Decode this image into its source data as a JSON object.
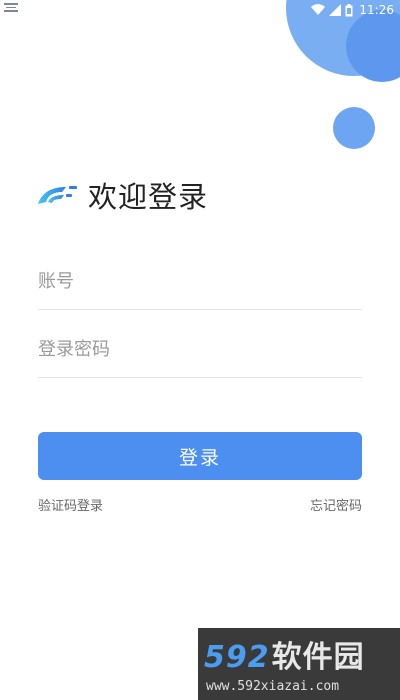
{
  "status_bar": {
    "time": "11:26",
    "icons": [
      "notification-icon",
      "wifi-icon",
      "signal-icon",
      "battery-icon"
    ]
  },
  "welcome": {
    "title": "欢迎登录",
    "logo_icon": "brand-logo-icon"
  },
  "form": {
    "account_placeholder": "账号",
    "password_placeholder": "登录密码",
    "login_label": "登录",
    "sms_login_label": "验证码登录",
    "forgot_password_label": "忘记密码"
  },
  "watermark": {
    "logo_digits": "592",
    "logo_text": "软件园",
    "url": "www.592xiazai.com"
  },
  "colors": {
    "primary": "#4d8ff0",
    "circle_light": "#79aef2",
    "circle_dark": "#5d97ee",
    "watermark_bg": "#3a3a3a"
  }
}
